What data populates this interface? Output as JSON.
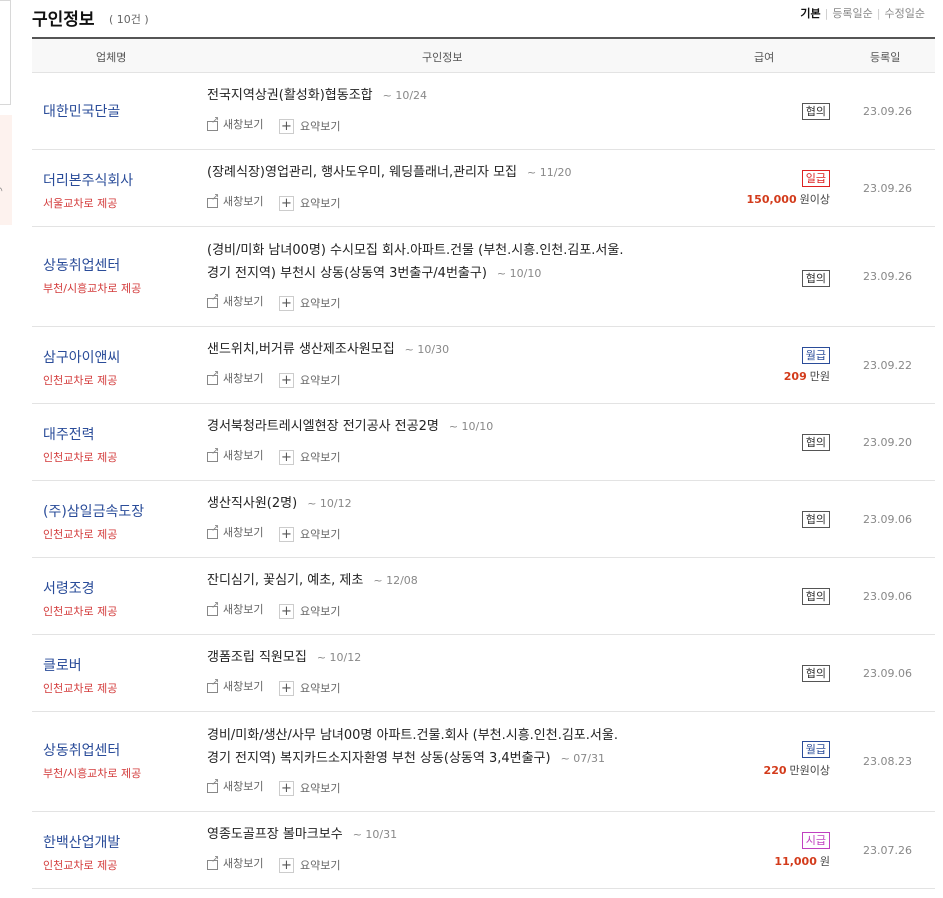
{
  "header": {
    "title": "구인정보",
    "count": "( 10건 )",
    "sort_options": [
      "기본",
      "등록일순",
      "수정일순"
    ],
    "active_sort": 0
  },
  "columns": {
    "company": "업체명",
    "info": "구인정보",
    "pay": "급여",
    "date": "등록일"
  },
  "actions": {
    "new_window": "새창보기",
    "summary": "요약보기"
  },
  "rows": [
    {
      "company": "대한민국단골",
      "provider": "",
      "title_lines": [
        "전국지역상권(활성화)협동조합"
      ],
      "deadline": "~ 10/24",
      "pay_type": "협의",
      "pay_kind": "negotiable",
      "amount": "",
      "unit": "",
      "date": "23.09.26"
    },
    {
      "company": "더리본주식회사",
      "provider": "서울교차로 제공",
      "title_lines": [
        "(장례식장)영업관리, 행사도우미, 웨딩플래너,관리자 모집"
      ],
      "deadline": "~ 11/20",
      "pay_type": "일급",
      "pay_kind": "daily",
      "amount": "150,000",
      "unit": "원이상",
      "date": "23.09.26"
    },
    {
      "company": "상동취업센터",
      "provider": "부천/시흥교차로 제공",
      "title_lines": [
        "(경비/미화 남녀00명) 수시모집 회사.아파트.건물 (부천.시흥.인천.김포.서울.",
        "경기 전지역) 부천시 상동(상동역 3번출구/4번출구)"
      ],
      "deadline": "~ 10/10",
      "pay_type": "협의",
      "pay_kind": "negotiable",
      "amount": "",
      "unit": "",
      "date": "23.09.26"
    },
    {
      "company": "삼구아이앤씨",
      "provider": "인천교차로 제공",
      "title_lines": [
        "샌드위치,버거류 생산제조사원모집"
      ],
      "deadline": "~ 10/30",
      "pay_type": "월급",
      "pay_kind": "monthly",
      "amount": "209",
      "unit": "만원",
      "date": "23.09.22"
    },
    {
      "company": "대주전력",
      "provider": "인천교차로 제공",
      "title_lines": [
        "경서북청라트레시엘현장 전기공사 전공2명"
      ],
      "deadline": "~ 10/10",
      "pay_type": "협의",
      "pay_kind": "negotiable",
      "amount": "",
      "unit": "",
      "date": "23.09.20"
    },
    {
      "company": "(주)삼일금속도장",
      "provider": "인천교차로 제공",
      "title_lines": [
        "생산직사원(2명)"
      ],
      "deadline": "~ 10/12",
      "pay_type": "협의",
      "pay_kind": "negotiable",
      "amount": "",
      "unit": "",
      "date": "23.09.06"
    },
    {
      "company": "서령조경",
      "provider": "인천교차로 제공",
      "title_lines": [
        "잔디심기, 꽃심기, 예초, 제초"
      ],
      "deadline": "~ 12/08",
      "pay_type": "협의",
      "pay_kind": "negotiable",
      "amount": "",
      "unit": "",
      "date": "23.09.06"
    },
    {
      "company": "클로버",
      "provider": "인천교차로 제공",
      "title_lines": [
        "갱폼조립 직원모집"
      ],
      "deadline": "~ 10/12",
      "pay_type": "협의",
      "pay_kind": "negotiable",
      "amount": "",
      "unit": "",
      "date": "23.09.06"
    },
    {
      "company": "상동취업센터",
      "provider": "부천/시흥교차로 제공",
      "title_lines": [
        "경비/미화/생산/사무 남녀00명 아파트.건물.회사 (부천.시흥.인천.김포.서울.",
        "경기 전지역) 복지카드소지자환영 부천 상동(상동역 3,4번출구)"
      ],
      "deadline": "~ 07/31",
      "pay_type": "월급",
      "pay_kind": "monthly",
      "amount": "220",
      "unit": "만원이상",
      "date": "23.08.23"
    },
    {
      "company": "한백산업개발",
      "provider": "인천교차로 제공",
      "title_lines": [
        "영종도골프장 볼마크보수"
      ],
      "deadline": "~ 10/31",
      "pay_type": "시급",
      "pay_kind": "hourly",
      "amount": "11,000",
      "unit": "원",
      "date": "23.07.26"
    }
  ]
}
